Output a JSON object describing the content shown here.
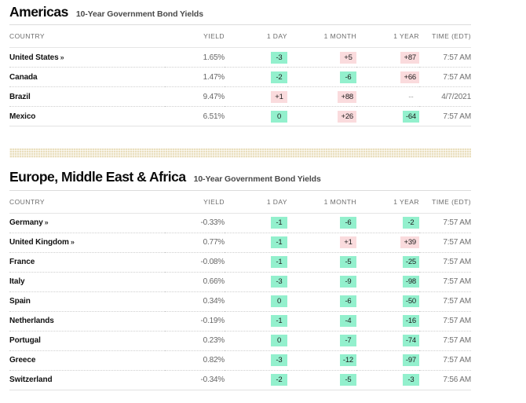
{
  "colors": {
    "up_badge_bg": "#fadbdd",
    "down_badge_bg": "#93f0cd",
    "divider_band": "#eadfbe",
    "text_primary": "#111111",
    "text_muted": "#6d6d6d"
  },
  "columns": {
    "country": "COUNTRY",
    "yield": "YIELD",
    "day1": "1 DAY",
    "month1": "1 MONTH",
    "year1": "1 YEAR",
    "time": "TIME (EDT)"
  },
  "sections": [
    {
      "title": "Americas",
      "subtitle": "10-Year Government Bond Yields",
      "rows": [
        {
          "country": "United States",
          "has_link": true,
          "chevron": "»",
          "yield": "1.65%",
          "day1": {
            "value": "-3",
            "dir": "down"
          },
          "month1": {
            "value": "+5",
            "dir": "up"
          },
          "year1": {
            "value": "+87",
            "dir": "up"
          },
          "time": "7:57 AM"
        },
        {
          "country": "Canada",
          "has_link": false,
          "chevron": "",
          "yield": "1.47%",
          "day1": {
            "value": "-2",
            "dir": "down"
          },
          "month1": {
            "value": "-6",
            "dir": "down"
          },
          "year1": {
            "value": "+66",
            "dir": "up"
          },
          "time": "7:57 AM"
        },
        {
          "country": "Brazil",
          "has_link": false,
          "chevron": "",
          "yield": "9.47%",
          "day1": {
            "value": "+1",
            "dir": "up"
          },
          "month1": {
            "value": "+88",
            "dir": "up"
          },
          "year1": {
            "value": "--",
            "dir": "none"
          },
          "time": "4/7/2021"
        },
        {
          "country": "Mexico",
          "has_link": false,
          "chevron": "",
          "yield": "6.51%",
          "day1": {
            "value": "0",
            "dir": "down"
          },
          "month1": {
            "value": "+26",
            "dir": "up"
          },
          "year1": {
            "value": "-64",
            "dir": "down"
          },
          "time": "7:57 AM"
        }
      ]
    },
    {
      "title": "Europe, Middle East & Africa",
      "subtitle": "10-Year Government Bond Yields",
      "rows": [
        {
          "country": "Germany",
          "has_link": true,
          "chevron": "»",
          "yield": "-0.33%",
          "day1": {
            "value": "-1",
            "dir": "down"
          },
          "month1": {
            "value": "-6",
            "dir": "down"
          },
          "year1": {
            "value": "-2",
            "dir": "down"
          },
          "time": "7:57 AM"
        },
        {
          "country": "United Kingdom",
          "has_link": true,
          "chevron": "»",
          "yield": "0.77%",
          "day1": {
            "value": "-1",
            "dir": "down"
          },
          "month1": {
            "value": "+1",
            "dir": "up"
          },
          "year1": {
            "value": "+39",
            "dir": "up"
          },
          "time": "7:57 AM"
        },
        {
          "country": "France",
          "has_link": false,
          "chevron": "",
          "yield": "-0.08%",
          "day1": {
            "value": "-1",
            "dir": "down"
          },
          "month1": {
            "value": "-5",
            "dir": "down"
          },
          "year1": {
            "value": "-25",
            "dir": "down"
          },
          "time": "7:57 AM"
        },
        {
          "country": "Italy",
          "has_link": false,
          "chevron": "",
          "yield": "0.66%",
          "day1": {
            "value": "-3",
            "dir": "down"
          },
          "month1": {
            "value": "-9",
            "dir": "down"
          },
          "year1": {
            "value": "-98",
            "dir": "down"
          },
          "time": "7:57 AM"
        },
        {
          "country": "Spain",
          "has_link": false,
          "chevron": "",
          "yield": "0.34%",
          "day1": {
            "value": "0",
            "dir": "down"
          },
          "month1": {
            "value": "-6",
            "dir": "down"
          },
          "year1": {
            "value": "-50",
            "dir": "down"
          },
          "time": "7:57 AM"
        },
        {
          "country": "Netherlands",
          "has_link": false,
          "chevron": "",
          "yield": "-0.19%",
          "day1": {
            "value": "-1",
            "dir": "down"
          },
          "month1": {
            "value": "-4",
            "dir": "down"
          },
          "year1": {
            "value": "-16",
            "dir": "down"
          },
          "time": "7:57 AM"
        },
        {
          "country": "Portugal",
          "has_link": false,
          "chevron": "",
          "yield": "0.23%",
          "day1": {
            "value": "0",
            "dir": "down"
          },
          "month1": {
            "value": "-7",
            "dir": "down"
          },
          "year1": {
            "value": "-74",
            "dir": "down"
          },
          "time": "7:57 AM"
        },
        {
          "country": "Greece",
          "has_link": false,
          "chevron": "",
          "yield": "0.82%",
          "day1": {
            "value": "-3",
            "dir": "down"
          },
          "month1": {
            "value": "-12",
            "dir": "down"
          },
          "year1": {
            "value": "-97",
            "dir": "down"
          },
          "time": "7:57 AM"
        },
        {
          "country": "Switzerland",
          "has_link": false,
          "chevron": "",
          "yield": "-0.34%",
          "day1": {
            "value": "-2",
            "dir": "down"
          },
          "month1": {
            "value": "-5",
            "dir": "down"
          },
          "year1": {
            "value": "-3",
            "dir": "down"
          },
          "time": "7:56 AM"
        }
      ]
    }
  ]
}
